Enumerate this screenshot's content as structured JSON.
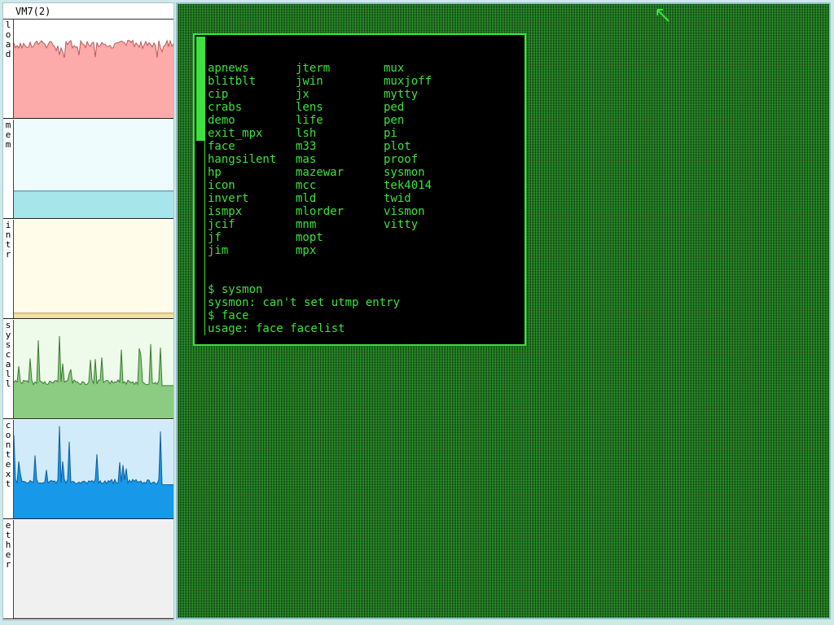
{
  "sysmon": {
    "title": "VM7(2)",
    "panels": [
      {
        "label": "load",
        "fill": "#fcaaaa",
        "line": "#b85a5a",
        "bg": "#ffffff"
      },
      {
        "label": "mem",
        "fill": "#a6e6ea",
        "line": "#2f7fb0",
        "bg": "#eefcfd"
      },
      {
        "label": "intr",
        "fill": "#f1e0a6",
        "line": "#b89a46",
        "bg": "#fffdea"
      },
      {
        "label": "syscall",
        "fill": "#8ccc82",
        "line": "#3b7b33",
        "bg": "#eefbea"
      },
      {
        "label": "context",
        "fill": "#1898e8",
        "line": "#0f60a0",
        "bg": "#d2ebfb"
      },
      {
        "label": "ether",
        "fill": "#e2e2e2",
        "line": "#999999",
        "bg": "#f0f0f0"
      }
    ]
  },
  "terminal": {
    "columns": [
      [
        "apnews",
        "blitblt",
        "cip",
        "crabs",
        "demo",
        "exit_mpx",
        "face",
        "hangsilent",
        "hp",
        "icon",
        "invert",
        "ismpx",
        "jcif",
        "jf",
        "jim"
      ],
      [
        "jterm",
        "jwin",
        "jx",
        "lens",
        "life",
        "lsh",
        "m33",
        "mas",
        "mazewar",
        "mcc",
        "mld",
        "mlorder",
        "mnm",
        "mopt",
        "mpx"
      ],
      [
        "mux",
        "muxjoff",
        "mytty",
        "ped",
        "pen",
        "pi",
        "plot",
        "proof",
        "sysmon",
        "tek4014",
        "twid",
        "vismon",
        "vitty"
      ]
    ],
    "lines": [
      "$ sysmon",
      "sysmon: can't set utmp entry",
      "$ face",
      "usage: face facelist"
    ],
    "prompt": "$ "
  },
  "colors": {
    "terminal_green": "#3de23d",
    "terminal_bg": "#000000",
    "desktop_bg": "#0a1a0a"
  }
}
